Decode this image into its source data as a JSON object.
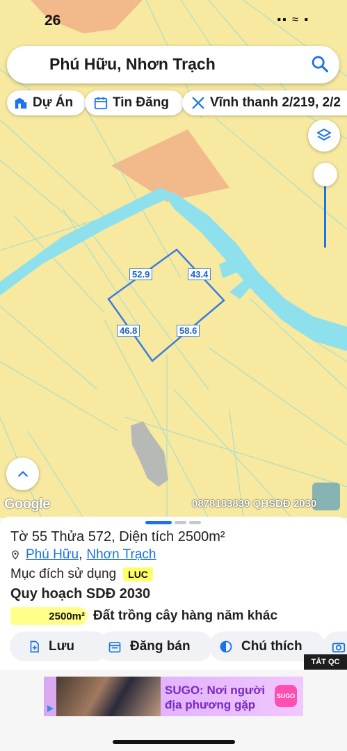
{
  "status_bar": {
    "time": "26",
    "icons_text": "▪▪ ≈ ▪"
  },
  "search": {
    "text": "Phú Hữu, Nhơn Trạch",
    "icon": "search-icon"
  },
  "filters": [
    {
      "label": "Dự Án",
      "icon": "building-icon"
    },
    {
      "label": "Tin Đăng",
      "icon": "calendar-icon"
    },
    {
      "label": "Vĩnh thanh 2/219, 2/2",
      "icon": "ruler-icon"
    }
  ],
  "parcel_edges": {
    "top_left": "52.9",
    "top_right": "43.4",
    "bottom_left": "46.8",
    "bottom_right": "58.6"
  },
  "map_brand": "Google",
  "watermark": "0878183839 QHSDĐ 2030",
  "parcel": {
    "title": "Tờ 55 Thửa 572, Diện tích 2500m²",
    "ward": "Phú Hữu",
    "separator": ",",
    "district": "Nhơn Trạch",
    "purpose_label": "Mục đích sử dụng",
    "purpose_code": "LUC",
    "plan_title": "Quy hoạch SDĐ 2030",
    "area": "2500m²",
    "land_type": "Đất trồng cây hàng năm khác"
  },
  "actions": [
    {
      "label": "Lưu",
      "icon": "bookmark-add-icon"
    },
    {
      "label": "Đăng bán",
      "icon": "calendar-icon"
    },
    {
      "label": "Chú thích",
      "icon": "contrast-icon"
    }
  ],
  "ad": {
    "badge": "TẮT QC",
    "line1": "SUGO: Nơi người",
    "line2": "địa phương gặp",
    "logo": "SUGO"
  },
  "colors": {
    "accent": "#1a73e8",
    "land": "#f7e9a0",
    "water": "#8ee0ec",
    "orange_zone": "#f2b98a",
    "plot_outline": "#3b7dde"
  }
}
